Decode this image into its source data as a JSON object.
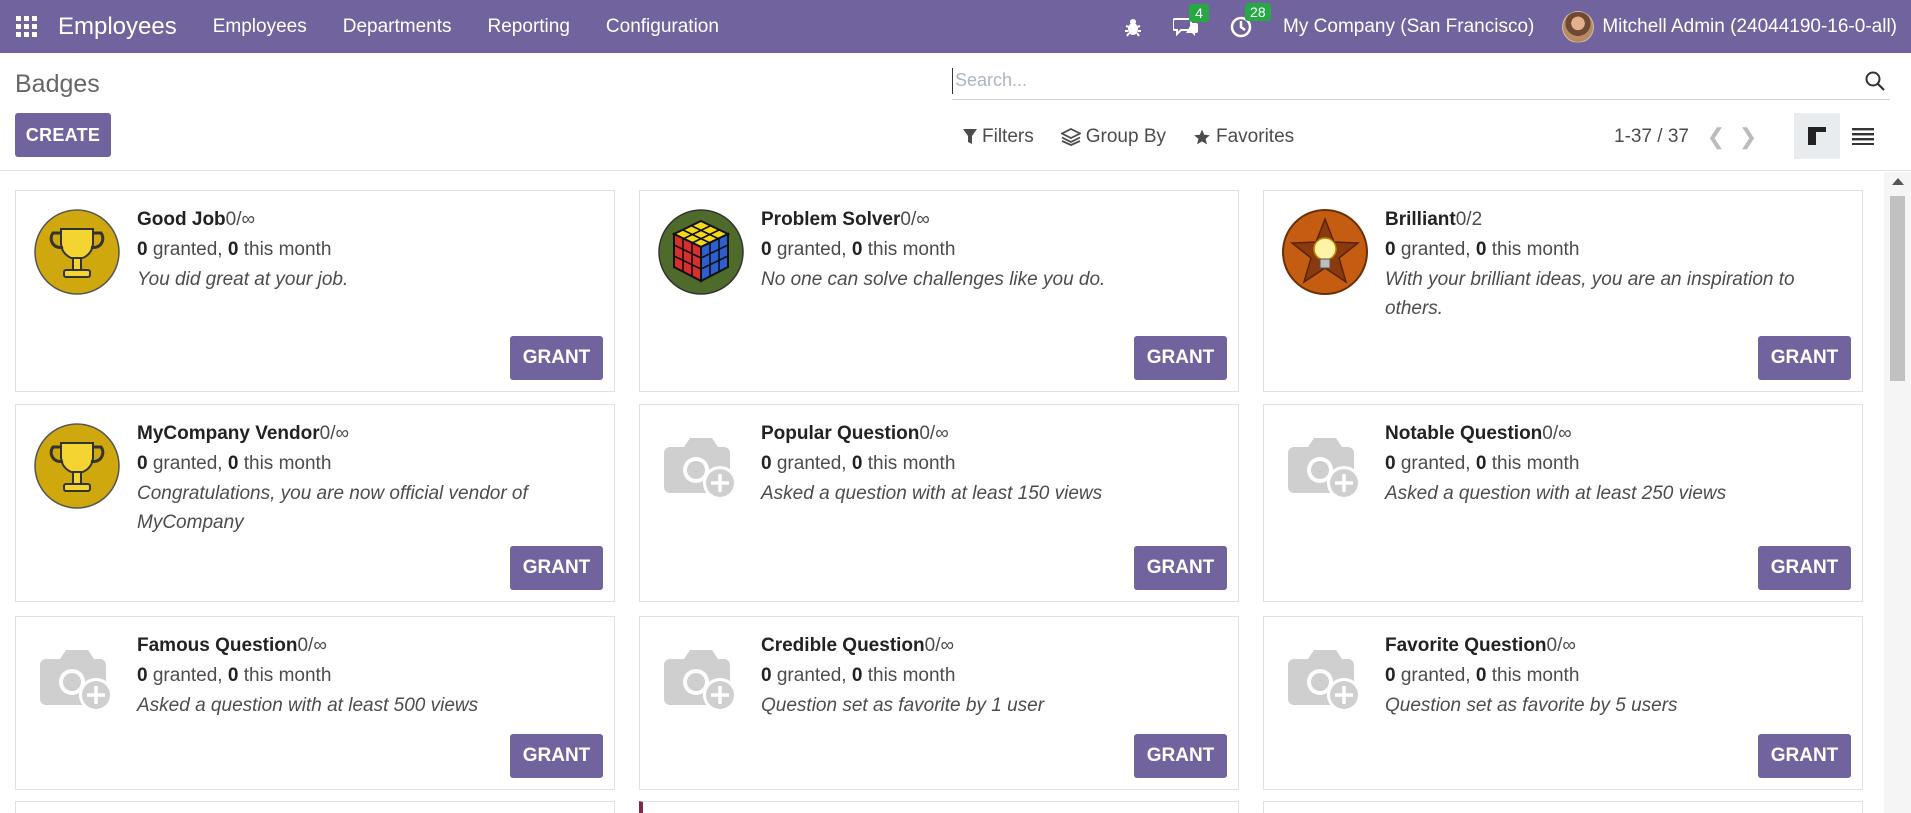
{
  "navbar": {
    "app_title": "Employees",
    "menu": [
      "Employees",
      "Departments",
      "Reporting",
      "Configuration"
    ],
    "messages_count": "4",
    "activities_count": "28",
    "company": "My Company (San Francisco)",
    "user": "Mitchell Admin (24044190-16-0-all)",
    "accent_color": "#71639e"
  },
  "control_panel": {
    "title": "Badges",
    "create_label": "CREATE",
    "search_placeholder": "Search...",
    "filters_label": "Filters",
    "group_by_label": "Group By",
    "favorites_label": "Favorites",
    "pager": "1-37 / 37"
  },
  "kanban": {
    "grant_label": "GRANT",
    "granted_word": "granted,",
    "month_word": "this month",
    "cards": [
      {
        "name": "Good Job",
        "count": "0/∞",
        "granted": "0",
        "month": "0",
        "desc": "You did great at your job.",
        "icon": "trophy-icon"
      },
      {
        "name": "Problem Solver",
        "count": "0/∞",
        "granted": "0",
        "month": "0",
        "desc": "No one can solve challenges like you do.",
        "icon": "rubiks-cube-icon"
      },
      {
        "name": "Brilliant",
        "count": "0/2",
        "granted": "0",
        "month": "0",
        "desc": "With your brilliant ideas, you are an inspiration to others.",
        "icon": "lightbulb-star-icon"
      },
      {
        "name": "MyCompany Vendor",
        "count": "0/∞",
        "granted": "0",
        "month": "0",
        "desc": "Congratulations, you are now official vendor of MyCompany",
        "icon": "trophy-icon"
      },
      {
        "name": "Popular Question",
        "count": "0/∞",
        "granted": "0",
        "month": "0",
        "desc": "Asked a question with at least 150 views",
        "icon": "camera-placeholder-icon"
      },
      {
        "name": "Notable Question",
        "count": "0/∞",
        "granted": "0",
        "month": "0",
        "desc": "Asked a question with at least 250 views",
        "icon": "camera-placeholder-icon"
      },
      {
        "name": "Famous Question",
        "count": "0/∞",
        "granted": "0",
        "month": "0",
        "desc": "Asked a question with at least 500 views",
        "icon": "camera-placeholder-icon"
      },
      {
        "name": "Credible Question",
        "count": "0/∞",
        "granted": "0",
        "month": "0",
        "desc": "Question set as favorite by 1 user",
        "icon": "camera-placeholder-icon"
      },
      {
        "name": "Favorite Question",
        "count": "0/∞",
        "granted": "0",
        "month": "0",
        "desc": "Question set as favorite by 5 users",
        "icon": "camera-placeholder-icon"
      }
    ]
  }
}
